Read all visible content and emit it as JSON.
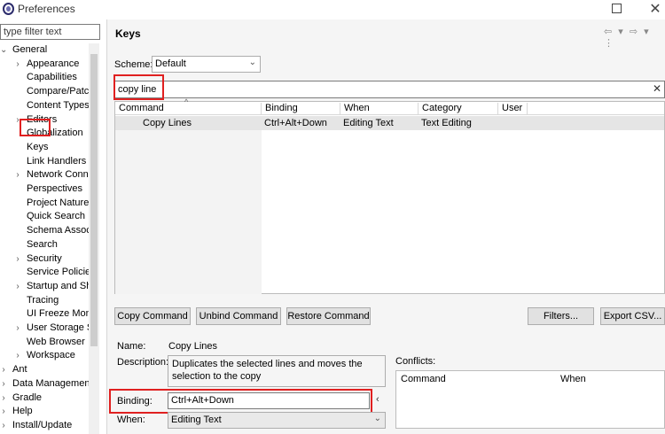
{
  "window": {
    "title": "Preferences"
  },
  "sidebar": {
    "filter_placeholder": "type filter text",
    "items": [
      {
        "label": "General",
        "expanded": true,
        "level": 0
      },
      {
        "label": "Appearance",
        "expandable": true,
        "level": 1
      },
      {
        "label": "Capabilities",
        "level": 1
      },
      {
        "label": "Compare/Patch",
        "level": 1
      },
      {
        "label": "Content Types",
        "level": 1
      },
      {
        "label": "Editors",
        "expandable": true,
        "level": 1
      },
      {
        "label": "Globalization",
        "level": 1
      },
      {
        "label": "Keys",
        "level": 1,
        "selected": true
      },
      {
        "label": "Link Handlers",
        "level": 1
      },
      {
        "label": "Network Conn",
        "expandable": true,
        "level": 1
      },
      {
        "label": "Perspectives",
        "level": 1
      },
      {
        "label": "Project Natures",
        "level": 1
      },
      {
        "label": "Quick Search",
        "level": 1
      },
      {
        "label": "Schema Associ",
        "level": 1
      },
      {
        "label": "Search",
        "level": 1
      },
      {
        "label": "Security",
        "expandable": true,
        "level": 1
      },
      {
        "label": "Service Policies",
        "level": 1
      },
      {
        "label": "Startup and Sh",
        "expandable": true,
        "level": 1
      },
      {
        "label": "Tracing",
        "level": 1
      },
      {
        "label": "UI Freeze Mon",
        "level": 1
      },
      {
        "label": "User Storage S",
        "expandable": true,
        "level": 1
      },
      {
        "label": "Web Browser",
        "level": 1
      },
      {
        "label": "Workspace",
        "expandable": true,
        "level": 1
      },
      {
        "label": "Ant",
        "expandable": true,
        "level": 0
      },
      {
        "label": "Data Management",
        "expandable": true,
        "level": 0
      },
      {
        "label": "Gradle",
        "expandable": true,
        "level": 0
      },
      {
        "label": "Help",
        "expandable": true,
        "level": 0
      },
      {
        "label": "Install/Update",
        "expandable": true,
        "level": 0
      }
    ]
  },
  "main": {
    "title": "Keys",
    "scheme_label": "Scheme:",
    "scheme_value": "Default",
    "search_value": "copy line",
    "table": {
      "headers": [
        "Command",
        "Binding",
        "When",
        "Category",
        "User"
      ],
      "rows": [
        {
          "command": "Copy Lines",
          "binding": "Ctrl+Alt+Down",
          "when": "Editing Text",
          "category": "Text Editing",
          "user": ""
        }
      ]
    },
    "buttons": {
      "copy": "Copy Command",
      "unbind": "Unbind Command",
      "restore": "Restore Command",
      "filters": "Filters...",
      "export": "Export CSV..."
    },
    "details": {
      "name_label": "Name:",
      "name_value": "Copy Lines",
      "description_label": "Description:",
      "description_value": "Duplicates the selected lines and moves the selection to the copy",
      "binding_label": "Binding:",
      "binding_value": "Ctrl+Alt+Down",
      "when_label": "When:",
      "when_value": "Editing Text"
    },
    "conflicts": {
      "label": "Conflicts:",
      "headers": [
        "Command",
        "When"
      ]
    }
  },
  "colors": {
    "highlight": "#e02020",
    "selection": "#e5e5e5"
  }
}
